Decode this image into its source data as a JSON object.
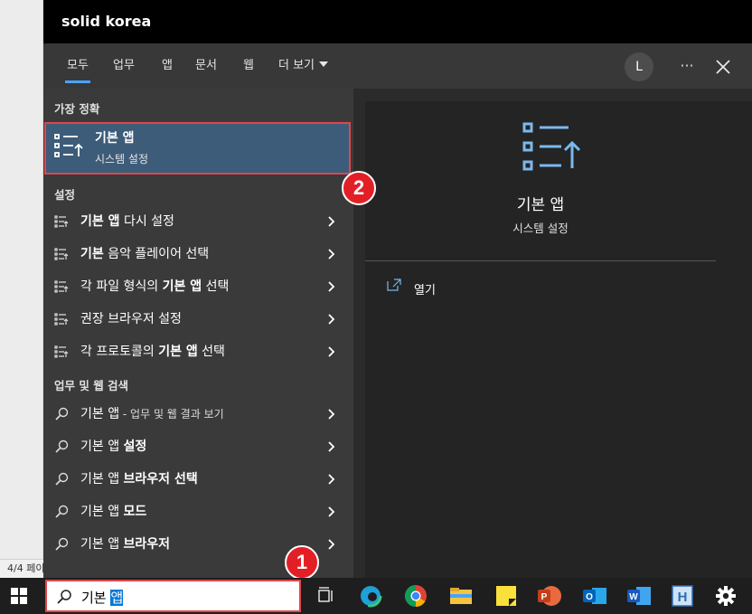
{
  "window": {
    "title": "solid korea"
  },
  "background": {
    "status": "4/4 페이"
  },
  "tabs": [
    {
      "label": "모두",
      "active": true
    },
    {
      "label": "업무"
    },
    {
      "label": "앱"
    },
    {
      "label": "문서"
    },
    {
      "label": "웹"
    },
    {
      "label": "더 보기"
    }
  ],
  "user": {
    "initial": "L"
  },
  "more_label": "···",
  "left_panel": {
    "best_match_header": "가장 정확",
    "best_match": {
      "title": "기본 앱",
      "subtitle": "시스템 설정",
      "icon": "default-apps-icon"
    },
    "settings_header": "설정",
    "settings": [
      {
        "bold": "기본 앱",
        "rest": " 다시 설정"
      },
      {
        "bold": "기본",
        "rest": " 음악 플레이어 선택"
      },
      {
        "pre": "각 파일 형식의 ",
        "bold": "기본 앱",
        "rest": " 선택"
      },
      {
        "pre": "",
        "bold": "",
        "rest": "권장 브라우저 설정"
      },
      {
        "pre": "각 프로토콜의 ",
        "bold": "기본 앱",
        "rest": " 선택"
      }
    ],
    "web_header": "업무 및 웹 검색",
    "web": [
      {
        "pre": "기본 앱",
        "small": " - 업무 및 웹 결과 보기",
        "bold": ""
      },
      {
        "pre": "기본 앱 ",
        "bold": "설정"
      },
      {
        "pre": "기본 앱 ",
        "bold": "브라우저 선택"
      },
      {
        "pre": "기본 앱 ",
        "bold": "모드"
      },
      {
        "pre": "기본 앱 ",
        "bold": "브라우저"
      }
    ]
  },
  "right_panel": {
    "title": "기본 앱",
    "subtitle": "시스템 설정",
    "action": "열기"
  },
  "badges": {
    "one": "1",
    "two": "2"
  },
  "taskbar": {
    "search_prefix": "기본 ",
    "search_selected": "앱",
    "apps": [
      "task-view-icon",
      "edge-icon",
      "chrome-icon",
      "file-explorer-icon",
      "sticky-notes-icon",
      "powerpoint-icon",
      "outlook-icon",
      "word-icon",
      "hangul-icon",
      "settings-icon"
    ]
  },
  "colors": {
    "accent": "#4aa3ff",
    "highlight": "#3d5c7a",
    "annotation": "#e31f26"
  }
}
